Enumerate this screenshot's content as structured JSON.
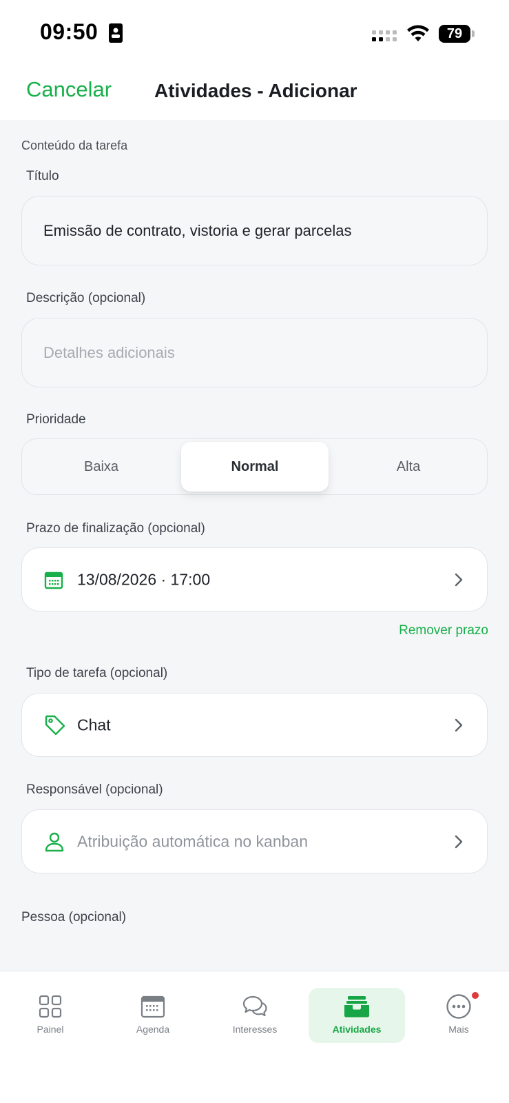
{
  "status": {
    "time": "09:50",
    "battery": "79"
  },
  "nav": {
    "cancel_label": "Cancelar",
    "title": "Atividades - Adicionar"
  },
  "form": {
    "section_header": "Conteúdo da tarefa",
    "title_label": "Título",
    "title_value": "Emissão de contrato, vistoria e gerar parcelas",
    "description_label": "Descrição (opcional)",
    "description_placeholder": "Detalhes adicionais",
    "priority_label": "Prioridade",
    "priority_options": [
      "Baixa",
      "Normal",
      "Alta"
    ],
    "priority_selected": "Normal",
    "deadline_label": "Prazo de finalização (opcional)",
    "deadline_value": "13/08/2026 · 17:00",
    "remove_deadline_label": "Remover prazo",
    "task_type_label": "Tipo de tarefa (opcional)",
    "task_type_value": "Chat",
    "assignee_label": "Responsável (opcional)",
    "assignee_placeholder": "Atribuição automática no kanban",
    "person_label": "Pessoa (opcional)"
  },
  "tabs": [
    {
      "label": "Painel",
      "icon": "grid-icon",
      "active": false
    },
    {
      "label": "Agenda",
      "icon": "calendar-icon",
      "active": false
    },
    {
      "label": "Interesses",
      "icon": "chat-bubbles-icon",
      "active": false
    },
    {
      "label": "Atividades",
      "icon": "inbox-tray-icon",
      "active": true
    },
    {
      "label": "Mais",
      "icon": "more-dots-icon",
      "active": false,
      "badge": true
    }
  ],
  "colors": {
    "accent": "#18b04a",
    "background": "#f5f6f8",
    "badge": "#e03a3a"
  }
}
